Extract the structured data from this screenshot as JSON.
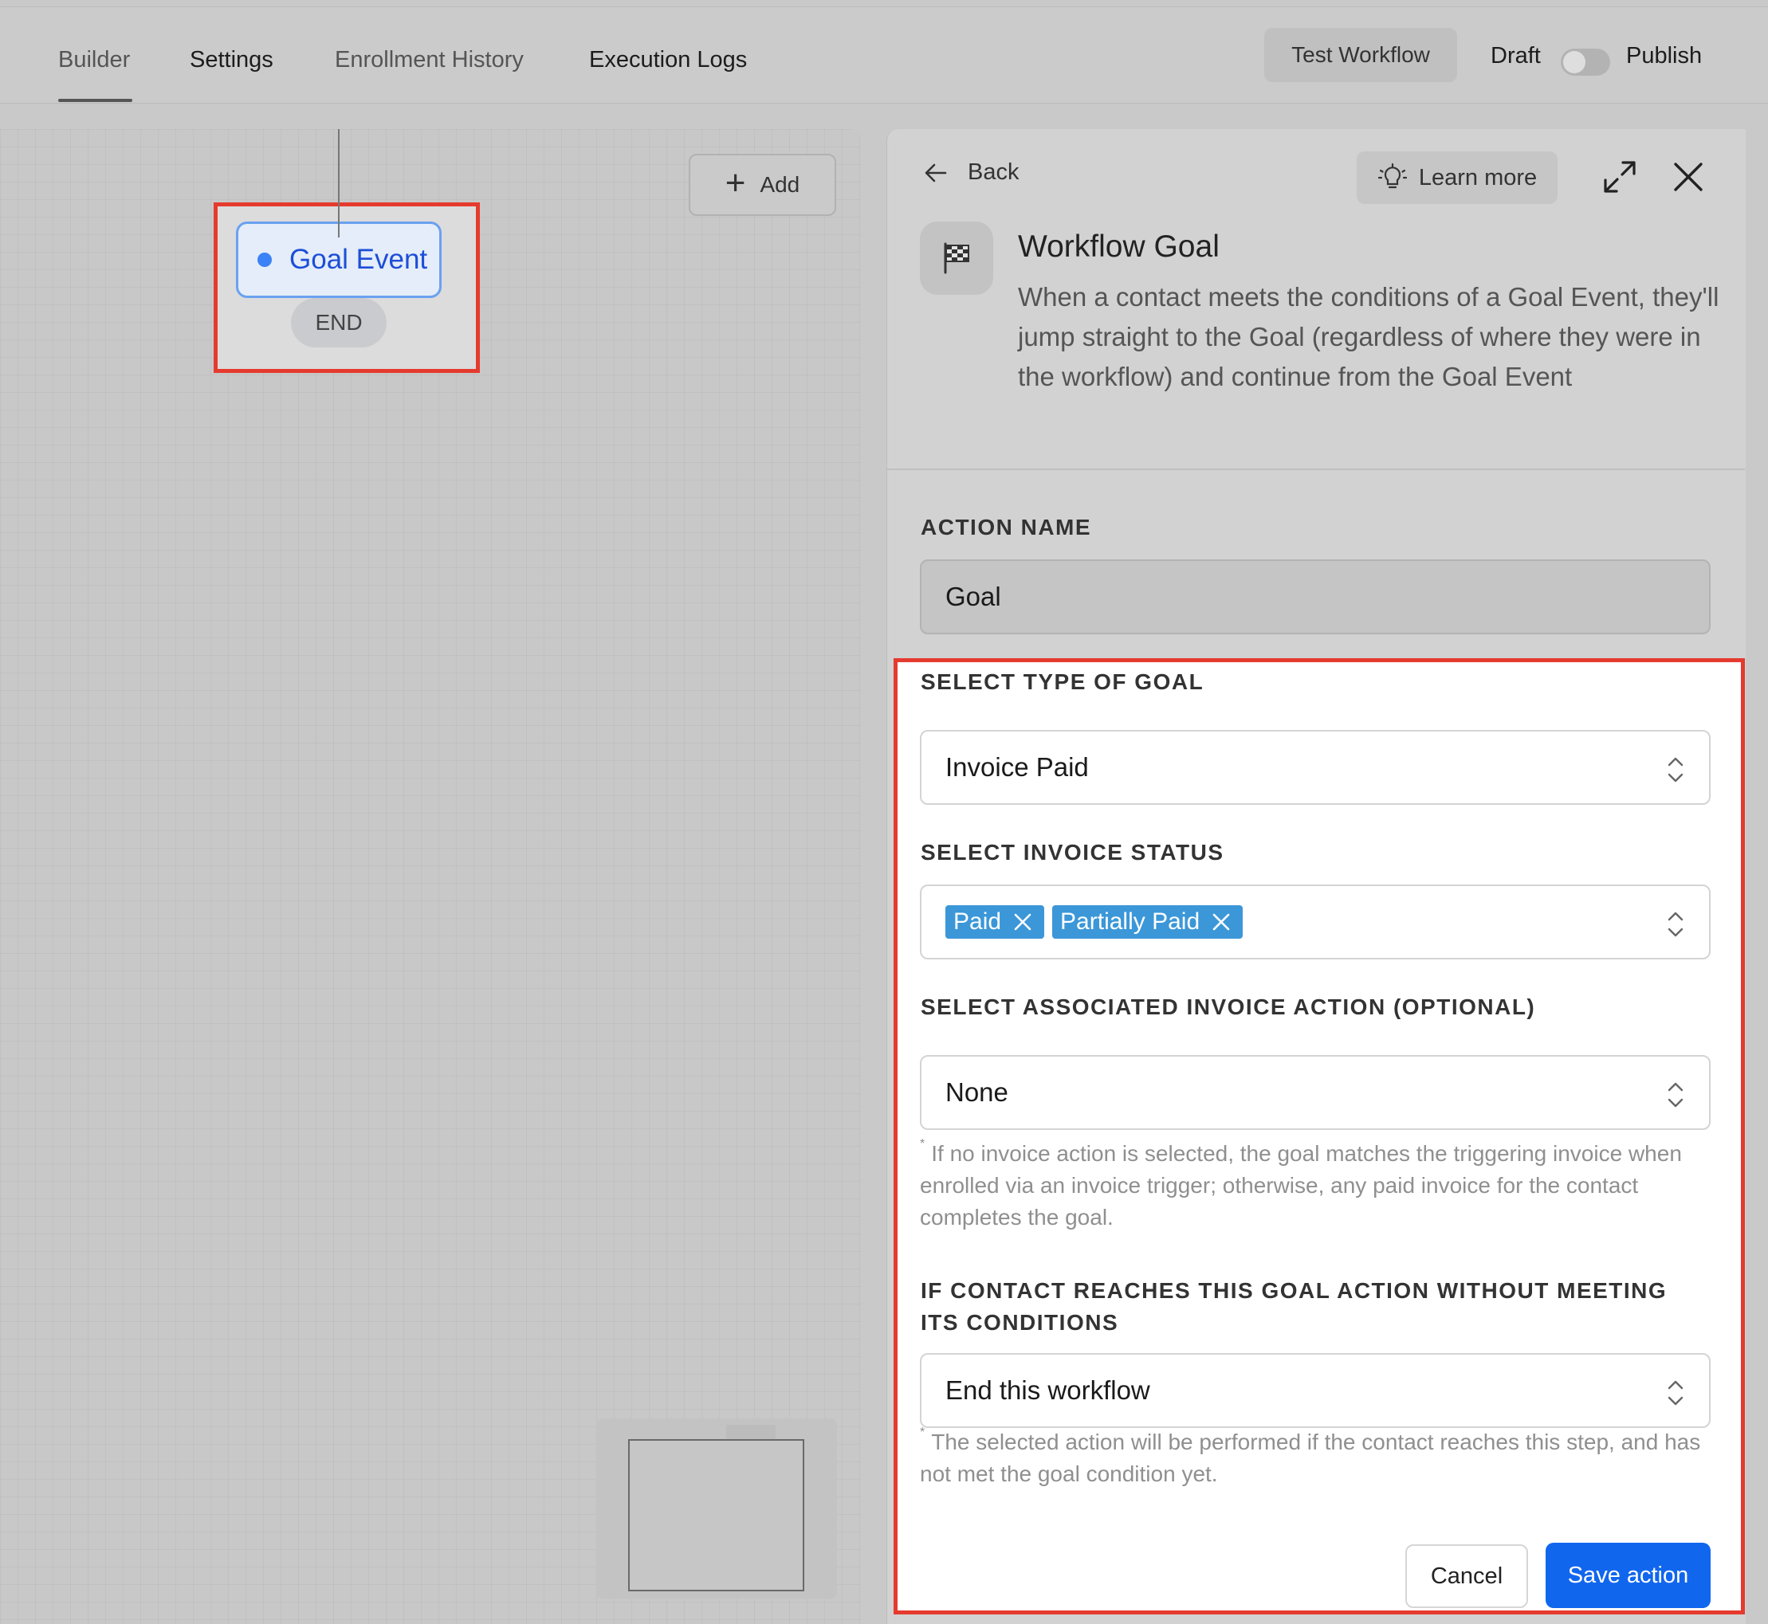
{
  "nav": {
    "tabs": [
      {
        "label": "Builder"
      },
      {
        "label": "Settings"
      },
      {
        "label": "Enrollment History"
      },
      {
        "label": "Execution Logs"
      }
    ],
    "test_workflow": "Test Workflow",
    "draft": "Draft",
    "publish": "Publish"
  },
  "canvas": {
    "add_label": "Add",
    "goal_node": "Goal Event",
    "end_label": "END"
  },
  "panel": {
    "back": "Back",
    "learn_more": "Learn more",
    "title": "Workflow Goal",
    "description": "When a contact meets the conditions of a Goal Event, they'll jump straight to the Goal (regardless of where they were in the workflow) and continue from the Goal Event",
    "action_name_label": "ACTION NAME",
    "action_name_value": "Goal",
    "goal_type_label": "SELECT TYPE OF GOAL",
    "goal_type_value": "Invoice Paid",
    "invoice_status_label": "SELECT INVOICE STATUS",
    "invoice_status_chips": [
      "Paid",
      "Partially Paid"
    ],
    "invoice_action_label": "SELECT ASSOCIATED INVOICE ACTION (OPTIONAL)",
    "invoice_action_value": "None",
    "invoice_action_hint": "If no invoice action is selected, the goal matches the triggering invoice when enrolled via an invoice trigger; otherwise, any paid invoice for the contact completes the goal.",
    "fallback_label": "IF CONTACT REACHES THIS GOAL ACTION WITHOUT MEETING ITS CONDITIONS",
    "fallback_value": "End this workflow",
    "fallback_hint": "The selected action will be performed if the contact reaches this step, and has not met the goal condition yet.",
    "asterisk": "*",
    "cancel": "Cancel",
    "save": "Save action"
  },
  "colors": {
    "primary": "#1166ee",
    "chip": "#3b97d8",
    "highlight": "#e53a2e",
    "goal_node": "#1d4ed8"
  }
}
